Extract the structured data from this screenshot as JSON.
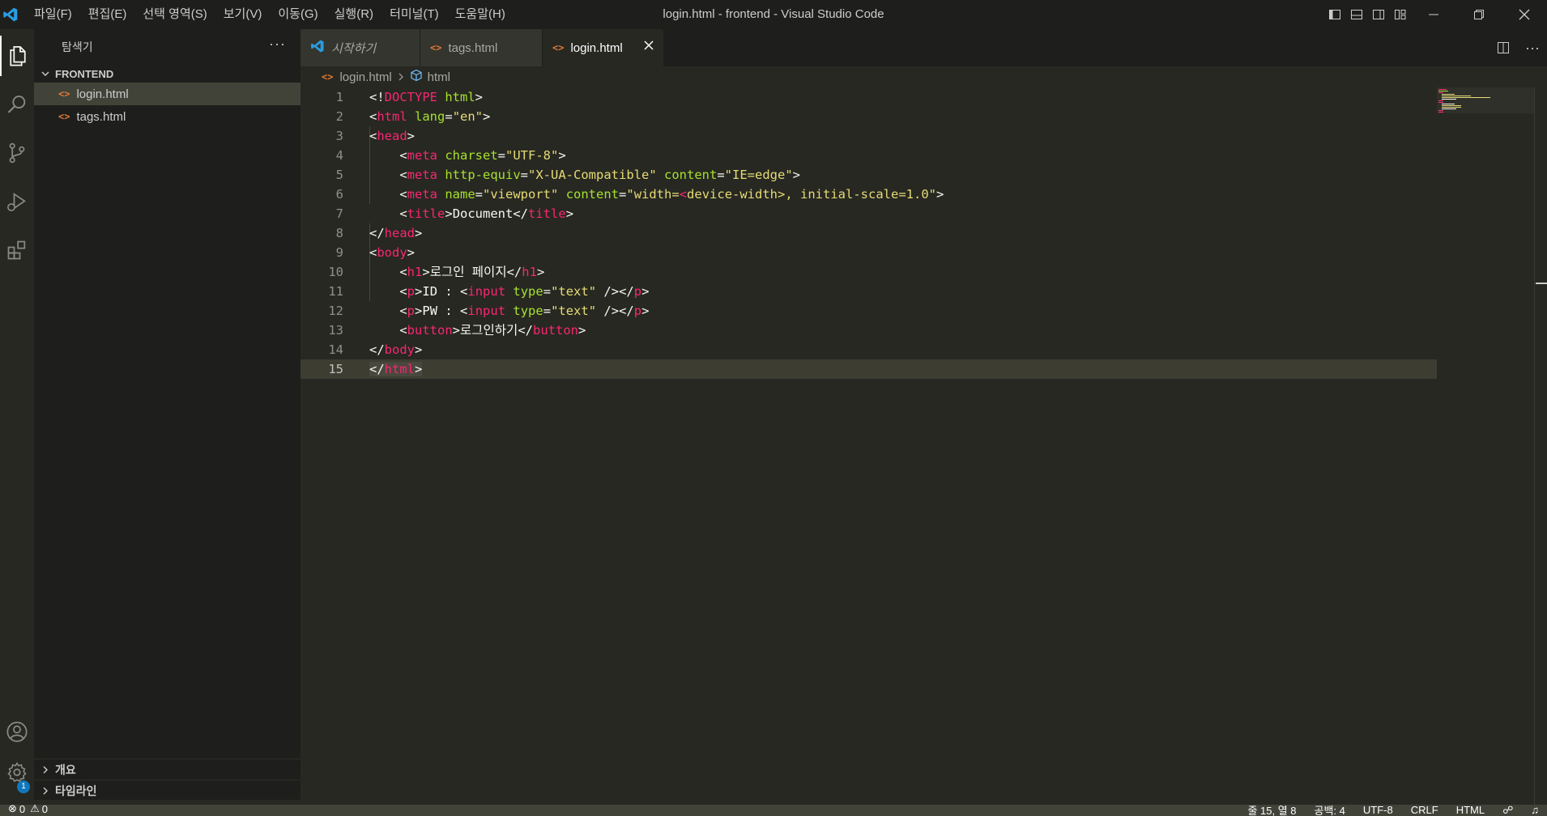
{
  "window": {
    "title": "login.html - frontend - Visual Studio Code"
  },
  "menu": [
    "파일(F)",
    "편집(E)",
    "선택 영역(S)",
    "보기(V)",
    "이동(G)",
    "실행(R)",
    "터미널(T)",
    "도움말(H)"
  ],
  "sidebar": {
    "title": "탐색기",
    "folder": "FRONTEND",
    "files": [
      "login.html",
      "tags.html"
    ],
    "sections": [
      "개요",
      "타임라인"
    ]
  },
  "tabs": [
    {
      "label": "시작하기"
    },
    {
      "label": "tags.html"
    },
    {
      "label": "login.html"
    }
  ],
  "breadcrumb": {
    "file": "login.html",
    "symbol": "html"
  },
  "editor": {
    "line_numbers": [
      "1",
      "2",
      "3",
      "4",
      "5",
      "6",
      "7",
      "8",
      "9",
      "10",
      "11",
      "12",
      "13",
      "14",
      "15"
    ],
    "current_line": 15
  },
  "accounts_badge": "1",
  "status": {
    "errors": "0",
    "warnings": "0",
    "position": "줄 15, 열 8",
    "spaces": "공백: 4",
    "encoding": "UTF-8",
    "eol": "CRLF",
    "language": "HTML"
  },
  "colors": {
    "tag": "#f92672",
    "attr": "#a6e22e",
    "string": "#e6db74",
    "background": "#272822",
    "sidebar": "#1e1f1c"
  },
  "icons": [
    "vscode-logo-icon",
    "explorer-icon",
    "search-icon",
    "source-control-icon",
    "run-debug-icon",
    "extensions-icon",
    "accounts-icon",
    "settings-gear-icon",
    "split-editor-icon",
    "more-icon"
  ]
}
